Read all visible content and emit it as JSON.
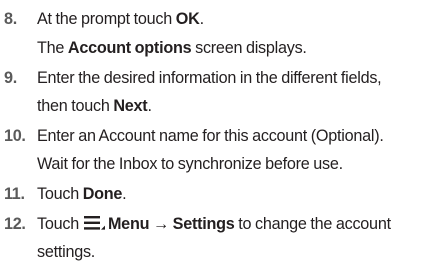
{
  "steps": [
    {
      "number": "8.",
      "parts": [
        "At the prompt touch ",
        "OK",
        "."
      ],
      "sub": [
        "The ",
        "Account options",
        " screen displays."
      ]
    },
    {
      "number": "9.",
      "line1": "Enter the desired information in the different fields,",
      "line2_parts": [
        "then touch ",
        "Next",
        "."
      ]
    },
    {
      "number": "10.",
      "line1": "Enter an Account name for this account (Optional).",
      "line2": "Wait for the Inbox to synchronize before use."
    },
    {
      "number": "11.",
      "parts": [
        "Touch ",
        "Done",
        "."
      ]
    },
    {
      "number": "12.",
      "parts": [
        "Touch",
        "Menu",
        "→",
        "Settings",
        "to change the account"
      ],
      "line2": "settings.",
      "icon": "menu-icon"
    }
  ]
}
